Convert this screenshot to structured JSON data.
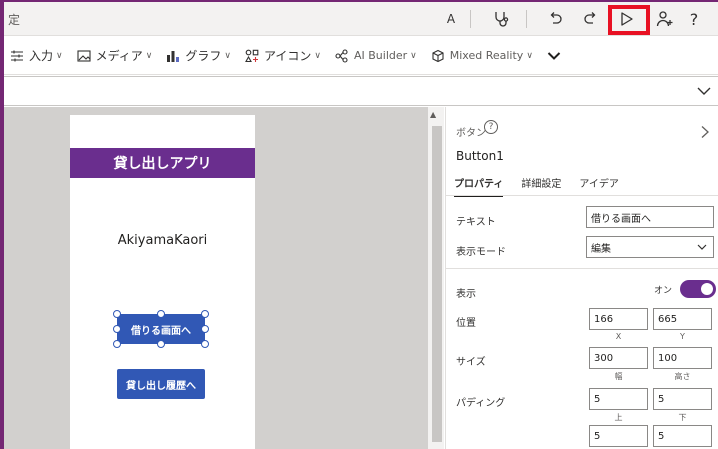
{
  "colors": {
    "accent": "#742774",
    "header_bg": "#6a2e8e",
    "button_bg": "#3158b5",
    "highlight": "#e81123"
  },
  "titlebar": {
    "fragment": "定",
    "font_btn": "A",
    "items": [
      {
        "icon": "stethoscope-icon"
      },
      {
        "icon": "undo-icon"
      },
      {
        "icon": "redo-icon"
      },
      {
        "icon": "play-icon"
      },
      {
        "icon": "person-add-icon"
      }
    ],
    "help": "?"
  },
  "ribbon": {
    "items": [
      {
        "label": "入力",
        "icon": "input-icon"
      },
      {
        "label": "メディア",
        "icon": "media-icon"
      },
      {
        "label": "グラフ",
        "icon": "chart-icon"
      },
      {
        "label": "アイコン",
        "icon": "icons-icon"
      },
      {
        "label": "AI Builder",
        "icon": "ai-builder-icon"
      },
      {
        "label": "Mixed Reality",
        "icon": "mixed-reality-icon"
      }
    ],
    "more_icon": "chevron-down-icon"
  },
  "canvas": {
    "app_title": "貸し出しアプリ",
    "user_name": "AkiyamaKaori",
    "button1": "借りる画面へ",
    "button2": "貸し出し履歴へ"
  },
  "panel": {
    "type_label": "ボタン",
    "help": "?",
    "control_name": "Button1",
    "tabs": [
      {
        "label": "プロパティ",
        "active": true
      },
      {
        "label": "詳細設定",
        "active": false
      },
      {
        "label": "アイデア",
        "active": false
      }
    ],
    "text_label": "テキスト",
    "text_value": "借りる画面へ",
    "mode_label": "表示モード",
    "mode_value": "編集",
    "visible_label": "表示",
    "visible_state": "オン",
    "position_label": "位置",
    "pos_x": "166",
    "pos_y": "665",
    "x_label": "X",
    "y_label": "Y",
    "size_label": "サイズ",
    "width": "300",
    "height": "100",
    "width_label": "幅",
    "height_label": "高さ",
    "padding_label": "パディング",
    "pad_top": "5",
    "pad_bottom": "5",
    "top_label": "上",
    "bottom_label": "下",
    "pad_left": "5",
    "pad_right": "5"
  }
}
